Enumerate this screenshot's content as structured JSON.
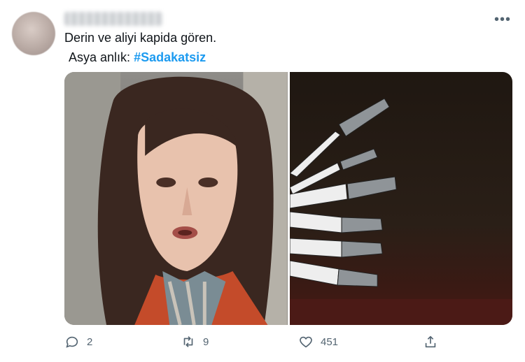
{
  "tweet": {
    "line1": "Derin ve aliyi kapida gören.",
    "line2_prefix": "Asya anlık:",
    "hashtag": "#Sadakatsiz"
  },
  "more_icon": "more-horizontal-icon",
  "media": {
    "left": "woman-shocked-photo",
    "right": "knives-stabbing-illustration"
  },
  "actions": {
    "reply_count": "2",
    "retweet_count": "9",
    "like_count": "451"
  },
  "colors": {
    "accent": "#1d9bf0",
    "muted": "#536471"
  }
}
